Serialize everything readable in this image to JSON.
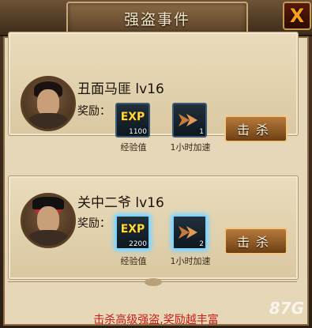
{
  "window": {
    "title": "强盗事件",
    "close_label": "X"
  },
  "common": {
    "reward_label": "奖励：",
    "kill_label": "击杀"
  },
  "bandits": [
    {
      "name": "丑面马匪  lv16",
      "exp_item": {
        "label": "经验值",
        "badge": "EXP",
        "qty": "1100"
      },
      "speed_item": {
        "label": "1小时加速",
        "qty": "1"
      }
    },
    {
      "name": "关中二爷  lv16",
      "exp_item": {
        "label": "经验值",
        "badge": "EXP",
        "qty": "2200"
      },
      "speed_item": {
        "label": "1小时加速",
        "qty": "2"
      }
    }
  ],
  "footer": {
    "hint": "击杀高级强盗,奖励越丰富"
  },
  "watermark": "87G"
}
